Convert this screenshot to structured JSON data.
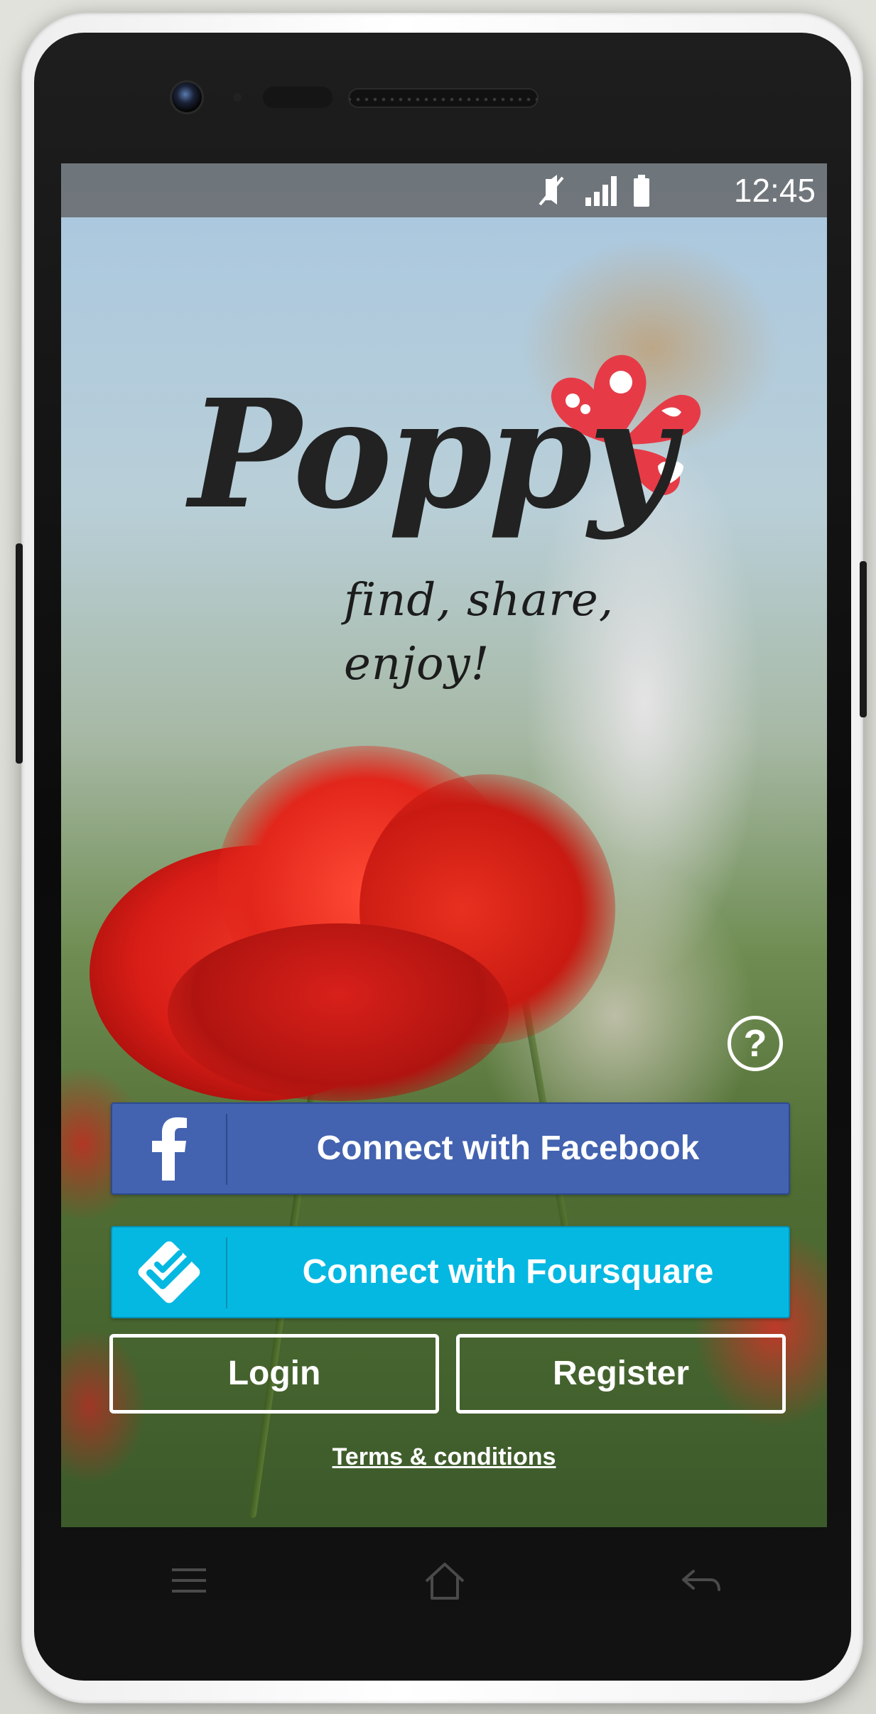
{
  "status_bar": {
    "time": "12:45",
    "icons": [
      "mute-icon",
      "signal-icon",
      "battery-icon"
    ]
  },
  "app": {
    "logo_text": "Poppy",
    "tagline": "find, share, enjoy!",
    "brand_color": "#e63b47"
  },
  "help": {
    "label": "?"
  },
  "buttons": {
    "facebook": {
      "label": "Connect with Facebook",
      "icon": "facebook-icon",
      "color": "#4363b0"
    },
    "foursquare": {
      "label": "Connect with Foursquare",
      "icon": "foursquare-icon",
      "color": "#05b8e2"
    },
    "login": "Login",
    "register": "Register"
  },
  "terms": {
    "label": "Terms & conditions"
  },
  "nav": [
    "menu-icon",
    "home-icon",
    "back-icon"
  ]
}
